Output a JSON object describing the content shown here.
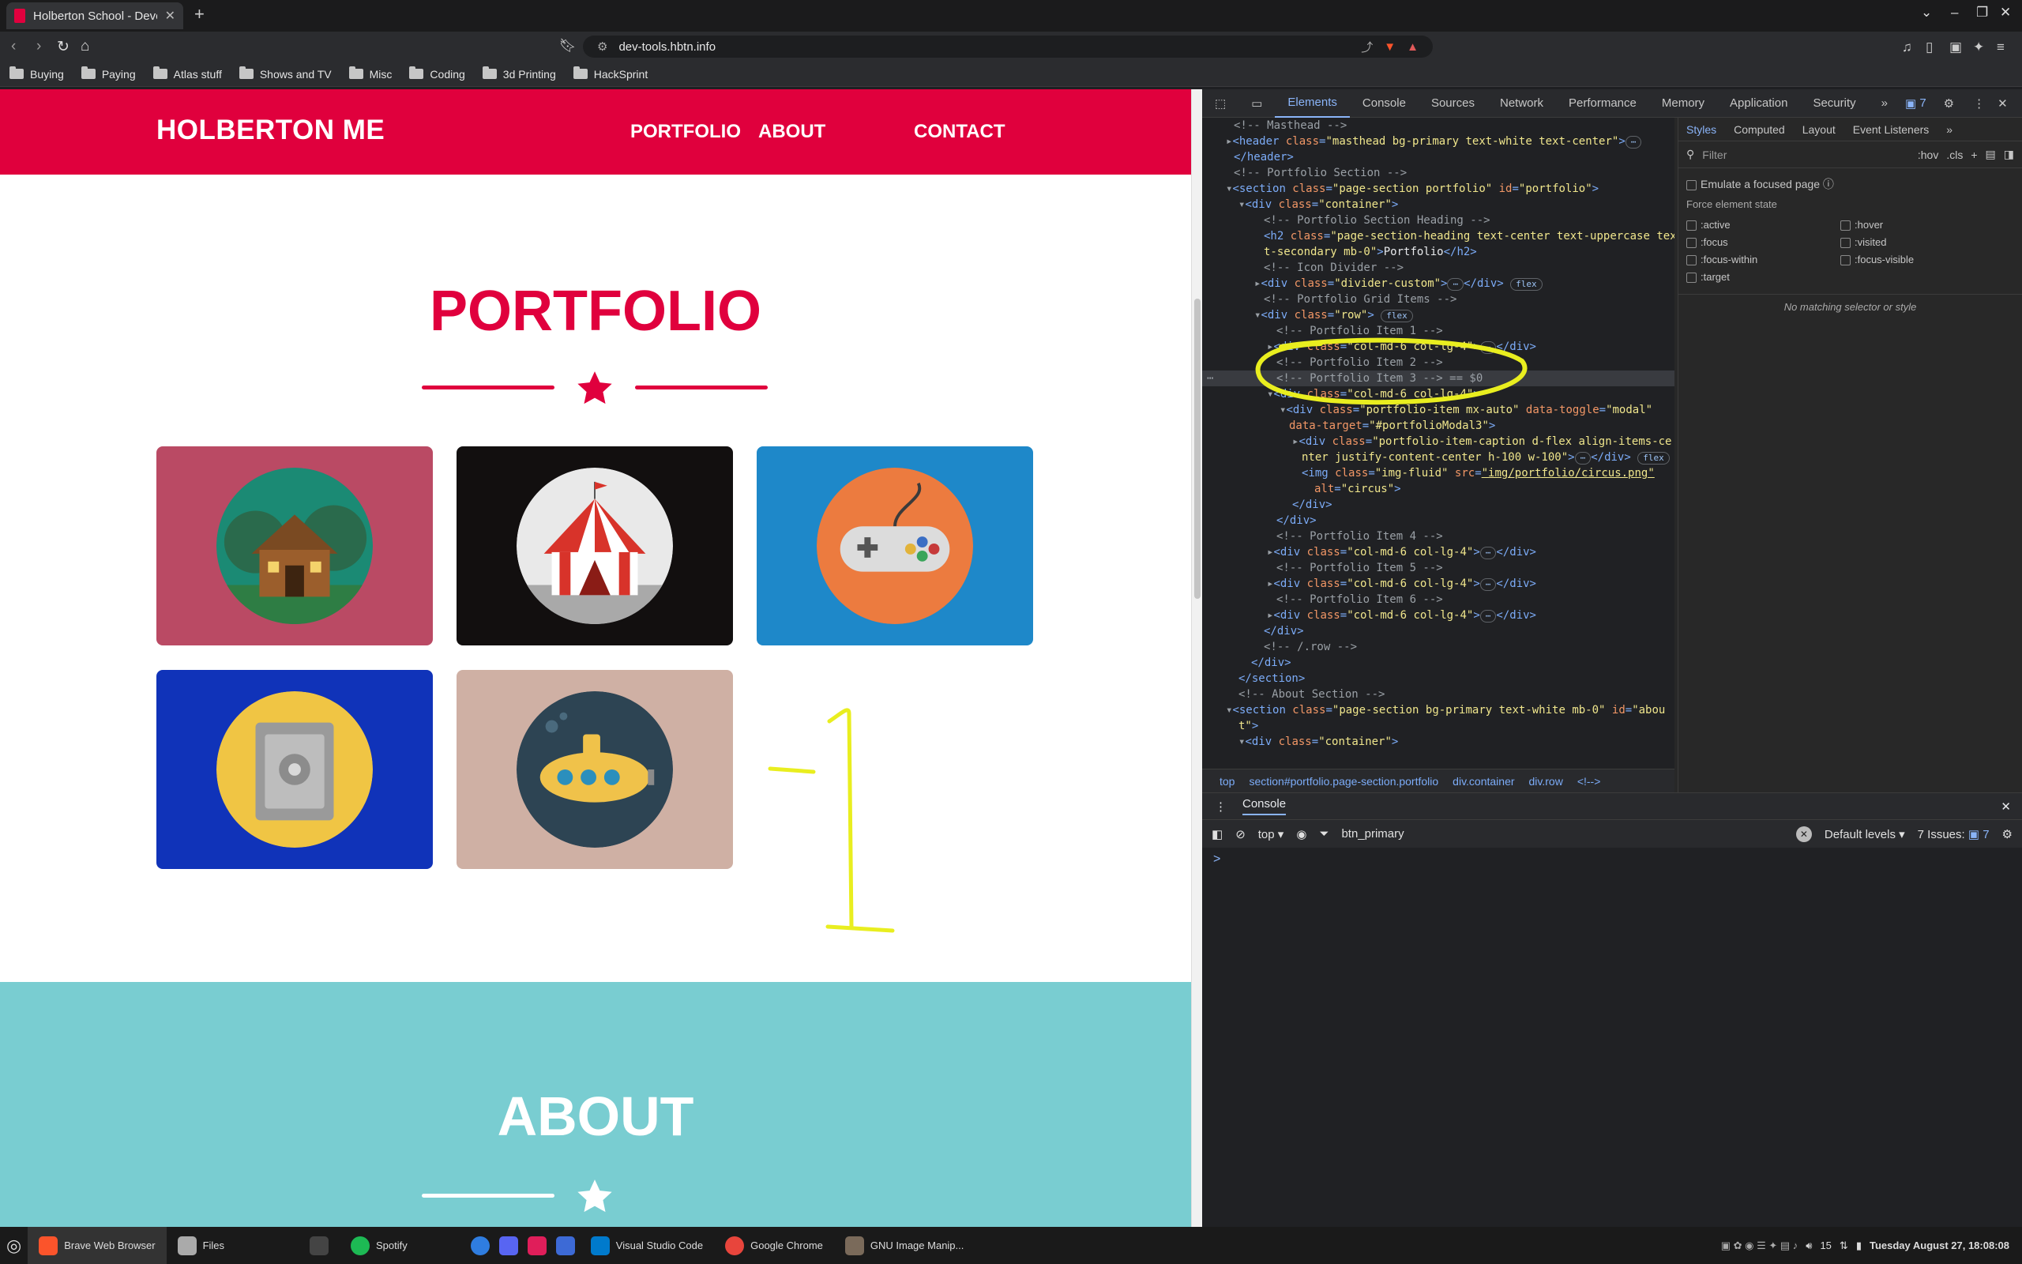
{
  "browser": {
    "tab_title": "Holberton School - Developer",
    "new_tab": "+",
    "url": "dev-tools.hbtn.info",
    "bookmarks": [
      "Buying",
      "Paying",
      "Atlas stuff",
      "Shows and TV",
      "Misc",
      "Coding",
      "3d Printing",
      "HackSprint"
    ]
  },
  "site": {
    "brand": "HOLBERTON ME",
    "nav": [
      "PORTFOLIO",
      "ABOUT",
      "CONTACT"
    ],
    "portfolio_title": "PORTFOLIO",
    "about_title": "ABOUT",
    "accent": "#e0003d",
    "portfolio_items": [
      {
        "name": "cabin",
        "bg": "#ba4a64",
        "circle": "#1b8a74"
      },
      {
        "name": "circus",
        "bg": "#120f0f",
        "circle": "#e9e9e9"
      },
      {
        "name": "game",
        "bg": "#1e88c9",
        "circle": "#ec7b3f"
      },
      {
        "name": "safe",
        "bg": "#1033b9",
        "circle": "#f0c544"
      },
      {
        "name": "submarine",
        "bg": "#cfb0a4",
        "circle": "#2d4453"
      }
    ],
    "annotation": "-1"
  },
  "devtools": {
    "tabs": [
      "Elements",
      "Console",
      "Sources",
      "Network",
      "Performance",
      "Memory",
      "Application",
      "Security"
    ],
    "issues_count": "7",
    "breadcrumbs": [
      "top",
      "section#portfolio.page-section.portfolio",
      "div.container",
      "div.row",
      "<!-->"
    ],
    "styles_tabs": [
      "Styles",
      "Computed",
      "Layout",
      "Event Listeners"
    ],
    "filter_placeholder": "Filter",
    "hov": ":hov",
    "cls": ".cls",
    "emulate_focus": "Emulate a focused page",
    "force_state": "Force element state",
    "states_left": [
      ":active",
      ":focus",
      ":focus-within",
      ":target"
    ],
    "states_right": [
      ":hover",
      ":visited",
      ":focus-visible"
    ],
    "no_match": "No matching selector or style",
    "console_title": "Console",
    "context": "top",
    "console_filter": "btn_primary",
    "levels": "Default levels",
    "issues_label": "7 Issues:",
    "issues_num": "7",
    "prompt": ">"
  },
  "taskbar": {
    "apps": [
      "Brave Web Browser",
      "Files",
      "",
      "Spotify",
      "",
      "",
      "",
      "",
      "Visual Studio Code",
      "Google Chrome",
      "GNU Image Manip..."
    ],
    "clock": "Tuesday August 27, 18:08:08",
    "volume": "15"
  }
}
